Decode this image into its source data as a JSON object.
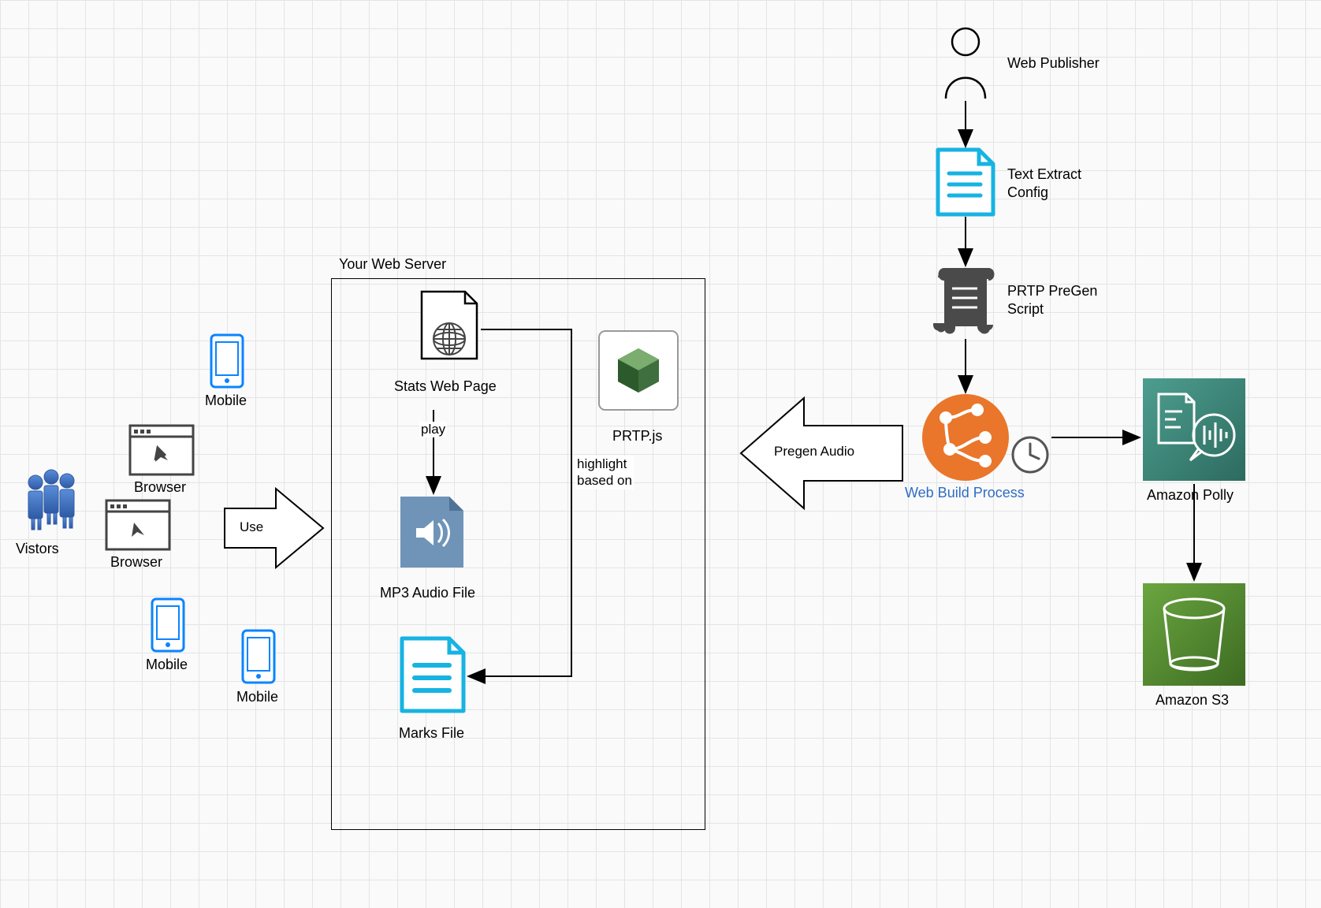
{
  "diagram": {
    "container_title": "Your Web Server",
    "nodes": {
      "visitors": "Vistors",
      "browser1": "Browser",
      "browser2": "Browser",
      "mobile1": "Mobile",
      "mobile2": "Mobile",
      "mobile3": "Mobile",
      "stats_web_page": "Stats Web Page",
      "prtpjs": "PRTP.js",
      "mp3_audio_file": "MP3 Audio File",
      "marks_file": "Marks File",
      "web_publisher": "Web Publisher",
      "text_extract_config_l1": "Text Extract",
      "text_extract_config_l2": "Config",
      "prtp_pregen_script_l1": "PRTP PreGen",
      "prtp_pregen_script_l2": "Script",
      "web_build_process": "Web Build Process",
      "amazon_polly": "Amazon Polly",
      "amazon_s3": "Amazon S3"
    },
    "edges": {
      "use": "Use",
      "play": "play",
      "highlight_l1": "highlight",
      "highlight_l2": "based on",
      "pregen_audio": "Pregen Audio"
    }
  }
}
